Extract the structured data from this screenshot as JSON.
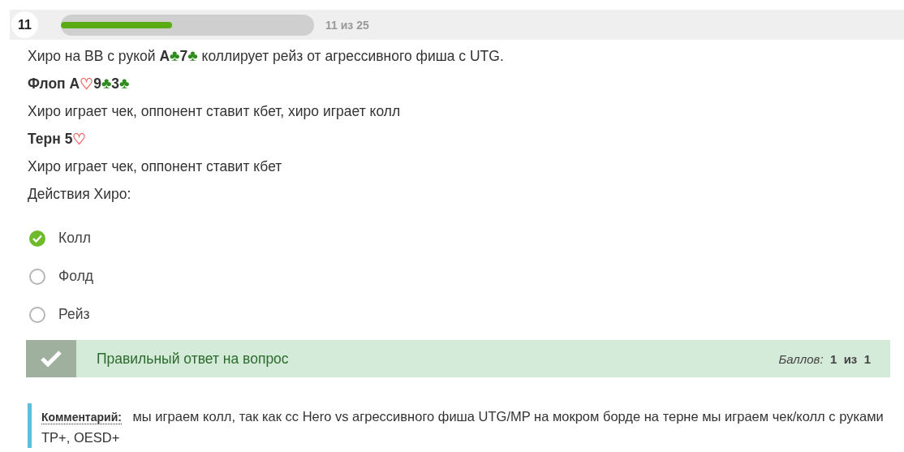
{
  "header": {
    "number": "11",
    "progress": {
      "level": 0.44
    },
    "counter": "11 из 25"
  },
  "question": [
    {
      "segments": [
        {
          "kind": "text",
          "text": "Хиро на BB с рукой "
        },
        {
          "kind": "bold",
          "text": "A"
        },
        {
          "kind": "club",
          "text": "♣"
        },
        {
          "kind": "bold",
          "text": "7"
        },
        {
          "kind": "club",
          "text": "♣"
        },
        {
          "kind": "text",
          "text": " коллирует рейз от агрессивного фиша с UTG."
        }
      ]
    },
    {
      "segments": [
        {
          "kind": "bold",
          "text": "Флоп A"
        },
        {
          "kind": "heart",
          "text": "♡"
        },
        {
          "kind": "bold",
          "text": "9"
        },
        {
          "kind": "club",
          "text": "♣"
        },
        {
          "kind": "bold",
          "text": "3"
        },
        {
          "kind": "club",
          "text": "♣"
        }
      ]
    },
    {
      "segments": [
        {
          "kind": "text",
          "text": "Хиро играет чек, оппонент ставит кбет, хиро играет колл"
        }
      ]
    },
    {
      "segments": [
        {
          "kind": "bold",
          "text": "Терн 5"
        },
        {
          "kind": "heart",
          "text": "♡"
        }
      ]
    },
    {
      "segments": [
        {
          "kind": "text",
          "text": "Хиро играет чек, оппонент ставит кбет"
        }
      ]
    },
    {
      "segments": [
        {
          "kind": "text",
          "text": "Действия Хиро:"
        }
      ]
    }
  ],
  "options": [
    {
      "label": "Колл",
      "selected": true
    },
    {
      "label": "Фолд",
      "selected": false
    },
    {
      "label": "Рейз",
      "selected": false
    }
  ],
  "result": {
    "message": "Правильный ответ на вопрос",
    "score_label": "Баллов:",
    "score": "1",
    "of": "из",
    "max": "1"
  },
  "comment": {
    "text": "**Комментарий:** мы играем колл, так как сс Hero vs  агрессивного фиша UTG/MP на мокром борде на терне мы играем чек/колл с руками TP+, OESD+"
  }
}
